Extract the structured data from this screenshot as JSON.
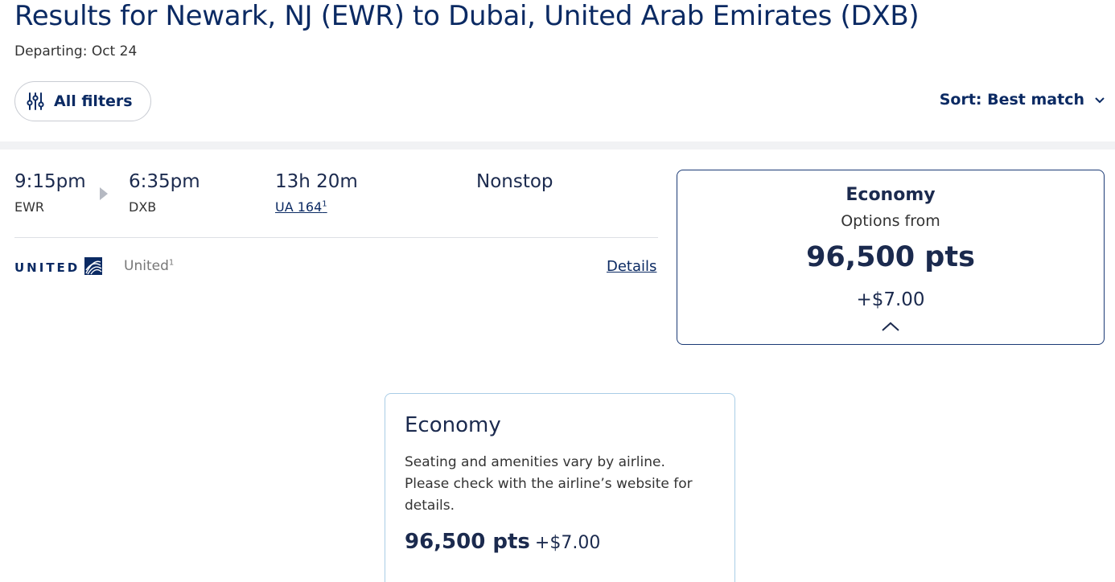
{
  "header": {
    "title": "Results for Newark, NJ (EWR) to Dubai, United Arab Emirates (DXB)",
    "departing": "Departing: Oct 24"
  },
  "toolbar": {
    "filters_label": "All filters",
    "sort_label": "Sort: Best match"
  },
  "flight": {
    "depart_time": "9:15pm",
    "depart_code": "EWR",
    "arrive_time": "6:35pm",
    "arrive_code": "DXB",
    "duration": "13h 20m",
    "flight_number": "UA 164",
    "flight_number_footnote": "1",
    "stops": "Nonstop",
    "airline_wordmark": "UNITED",
    "airline_name": "United",
    "airline_footnote": "1",
    "details_label": "Details"
  },
  "price_card": {
    "cabin": "Economy",
    "options": "Options from",
    "points": "96,500 pts",
    "fee": "+$7.00"
  },
  "detail_card": {
    "cabin": "Economy",
    "description": "Seating and amenities vary by airline. Please check with the airline’s website for details.",
    "points": "96,500 pts",
    "fee": "+$7.00"
  },
  "colors": {
    "brand_navy": "#0b2a63",
    "card_border": "#1b3a75",
    "detail_border": "#a9cde6"
  }
}
